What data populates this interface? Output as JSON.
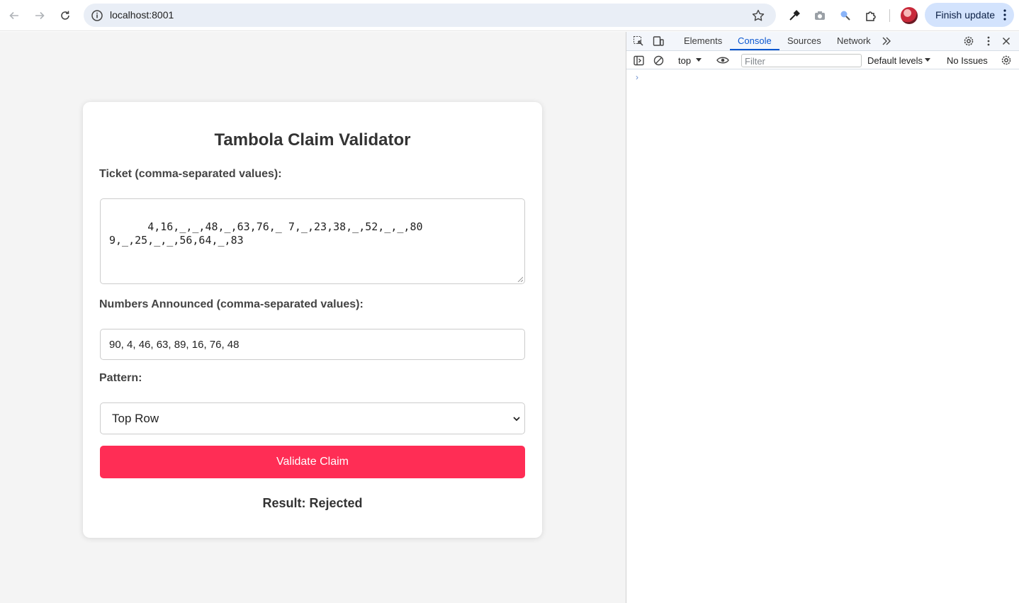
{
  "browser": {
    "url": "localhost:8001",
    "finish_update_label": "Finish update"
  },
  "app": {
    "title": "Tambola Claim Validator",
    "ticket_label": "Ticket (comma-separated values):",
    "ticket_value": "4,16,_,_,48,_,63,76,_ 7,_,23,38,_,52,_,_,80\n9,_,25,_,_,56,64,_,83",
    "announced_label": "Numbers Announced (comma-separated values):",
    "announced_value": "90, 4, 46, 63, 89, 16, 76, 48",
    "pattern_label": "Pattern:",
    "pattern_selected": "Top Row",
    "validate_label": "Validate Claim",
    "result_text": "Result: Rejected",
    "accent_color": "#ff2d55"
  },
  "devtools": {
    "tabs": [
      "Elements",
      "Console",
      "Sources",
      "Network"
    ],
    "active_tab": "Console",
    "context": "top",
    "filter_placeholder": "Filter",
    "levels_label": "Default levels",
    "issues_label": "No Issues",
    "prompt_symbol": "›"
  }
}
